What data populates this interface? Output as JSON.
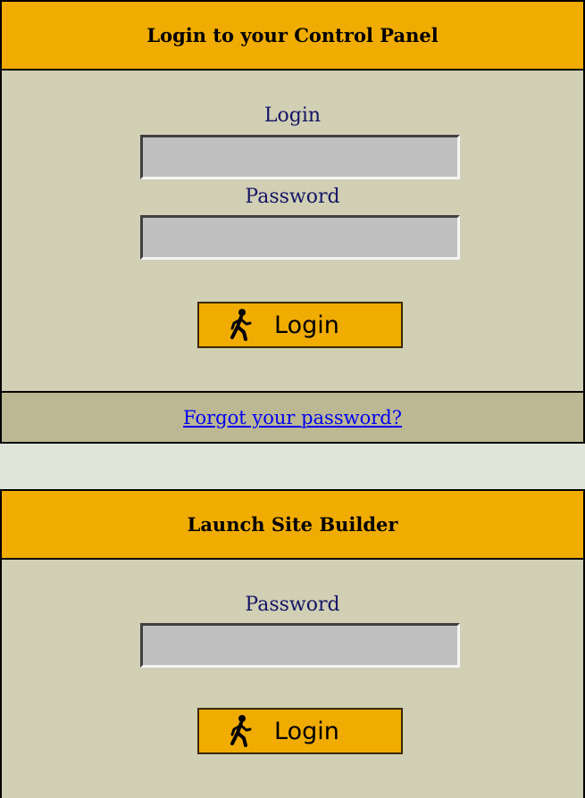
{
  "control_panel": {
    "title": "Login to your Control Panel",
    "login_label": "Login",
    "login_value": "",
    "password_label": "Password",
    "password_value": "",
    "button_label": "Login",
    "forgot_link": "Forgot your password?"
  },
  "site_builder": {
    "title": "Launch Site Builder",
    "password_label": "Password",
    "password_value": "",
    "button_label": "Login"
  },
  "colors": {
    "header_bg": "#f0ac00",
    "panel_bg": "#d1cfb4",
    "forgot_bar_bg": "#bdb894",
    "page_bg": "#e0e3d8",
    "label_text": "#141466",
    "link": "#0000ee"
  },
  "icons": {
    "button_icon": "walking-person-icon"
  }
}
